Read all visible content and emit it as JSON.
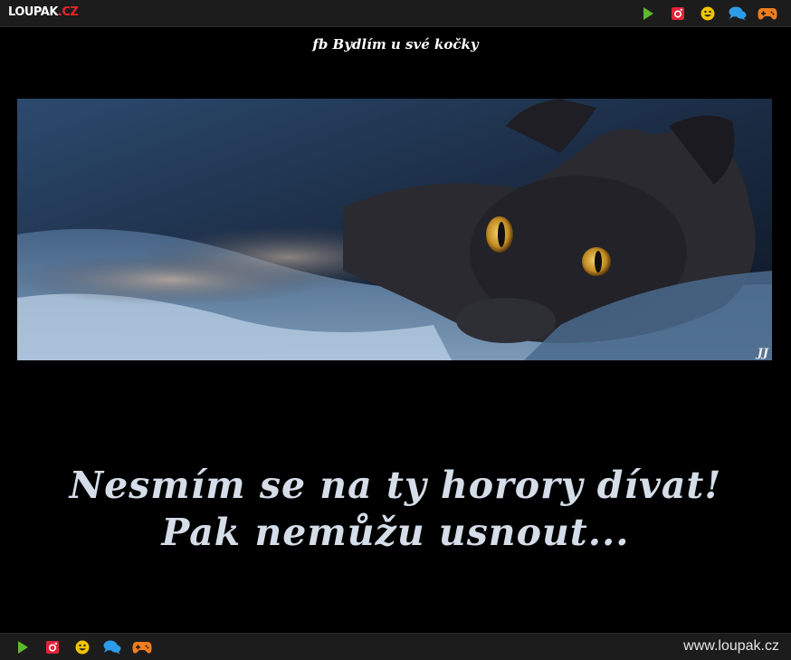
{
  "header": {
    "logo_main": "LOUPAK",
    "logo_tld": ".CZ",
    "icons": [
      "play-icon",
      "instagram-icon",
      "smiley-icon",
      "chat-icon",
      "gamepad-icon"
    ]
  },
  "post": {
    "caption": "fb Bydlím u své kočky",
    "signature": "JJ",
    "quote_line1": "Nesmím se na ty horory dívat!",
    "quote_line2": "Pak nemůžu usnout..."
  },
  "footer": {
    "icons": [
      "play-icon",
      "instagram-icon",
      "smiley-icon",
      "chat-icon",
      "gamepad-icon"
    ],
    "site_url": "www.loupak.cz"
  },
  "colors": {
    "play": "#5cb82e",
    "instagram": "#e3223a",
    "smiley": "#f2c500",
    "chat": "#2e9be8",
    "gamepad": "#f07d1e",
    "quote_text": "#d4dde8"
  }
}
